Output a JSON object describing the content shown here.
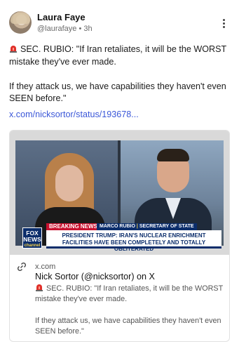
{
  "post": {
    "author_name": "Laura Faye",
    "handle_time": "@laurafaye • 3h",
    "menu_icon": "more-vertical-icon",
    "text_line1": "SEC. RUBIO: \"If Iran retaliates, it will be the WORST mistake they've ever made.",
    "text_line2": "If they attack us, we have capabilities they haven't even SEEN before.\"",
    "link": "x.com/nicksortor/status/193678..."
  },
  "card": {
    "tv": {
      "logo_top": "FOX",
      "logo_mid": "NEWS",
      "logo_bottom": "channel",
      "breaking": "BREAKING NEWS",
      "speaker": "MARCO RUBIO",
      "speaker_title": "SECRETARY OF STATE",
      "headline": "PRESIDENT TRUMP: IRAN'S NUCLEAR ENRICHMENT FACILITIES HAVE BEEN COMPLETELY AND TOTALLY OBLITERATED"
    },
    "domain": "x.com",
    "title": "Nick Sortor (@nicksortor) on X",
    "desc_line1": "SEC. RUBIO: \"If Iran retaliates, it will be the WORST mistake they've ever made.",
    "desc_line2": "If they attack us, we have capabilities they haven't even SEEN before.\""
  },
  "colors": {
    "link": "#3b57d8",
    "fox_blue": "#0b2d6b",
    "fox_red": "#c8102e"
  }
}
